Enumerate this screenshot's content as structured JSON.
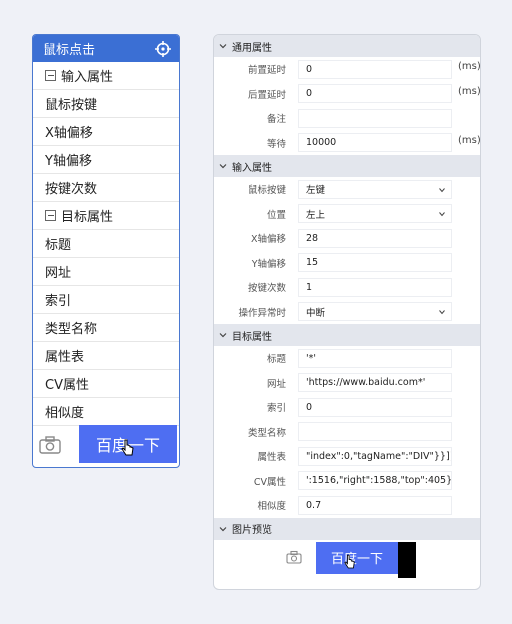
{
  "node": {
    "title": "鼠标点击",
    "icon": "crosshair-icon",
    "rows": [
      {
        "label": "输入属性",
        "group": true
      },
      {
        "label": "鼠标按键",
        "group": false
      },
      {
        "label": "X轴偏移",
        "group": false
      },
      {
        "label": "Y轴偏移",
        "group": false
      },
      {
        "label": "按键次数",
        "group": false
      },
      {
        "label": "目标属性",
        "group": true
      },
      {
        "label": "标题",
        "group": false
      },
      {
        "label": "网址",
        "group": false
      },
      {
        "label": "索引",
        "group": false
      },
      {
        "label": "类型名称",
        "group": false
      },
      {
        "label": "属性表",
        "group": false
      },
      {
        "label": "CV属性",
        "group": false
      },
      {
        "label": "相似度",
        "group": false
      }
    ],
    "preview_button": "百度一下"
  },
  "panel": {
    "sections": [
      {
        "title": "通用属性",
        "rows": [
          {
            "label": "前置延时",
            "value": "0",
            "unit": "(ms)"
          },
          {
            "label": "后置延时",
            "value": "0",
            "unit": "(ms)"
          },
          {
            "label": "备注",
            "value": ""
          },
          {
            "label": "等待",
            "value": "10000",
            "unit": "(ms)"
          }
        ]
      },
      {
        "title": "输入属性",
        "rows": [
          {
            "label": "鼠标按键",
            "value": "左键",
            "dropdown": true
          },
          {
            "label": "位置",
            "value": "左上",
            "dropdown": true
          },
          {
            "label": "X轴偏移",
            "value": "28"
          },
          {
            "label": "Y轴偏移",
            "value": "15"
          },
          {
            "label": "按键次数",
            "value": "1"
          },
          {
            "label": "操作异常时",
            "value": "中断",
            "dropdown": true
          }
        ]
      },
      {
        "title": "目标属性",
        "rows": [
          {
            "label": "标题",
            "value": "'*'"
          },
          {
            "label": "网址",
            "value": "'https://www.baidu.com*'"
          },
          {
            "label": "索引",
            "value": "0"
          },
          {
            "label": "类型名称",
            "value": ""
          },
          {
            "label": "属性表",
            "value": "\"index\":0,\"tagName\":\"DIV\"}}]}"
          },
          {
            "label": "CV属性",
            "value": "':1516,\"right\":1588,\"top\":405}}"
          },
          {
            "label": "相似度",
            "value": "0.7"
          }
        ]
      },
      {
        "title": "图片预览",
        "rows": []
      }
    ],
    "preview_button": "百度一下"
  }
}
